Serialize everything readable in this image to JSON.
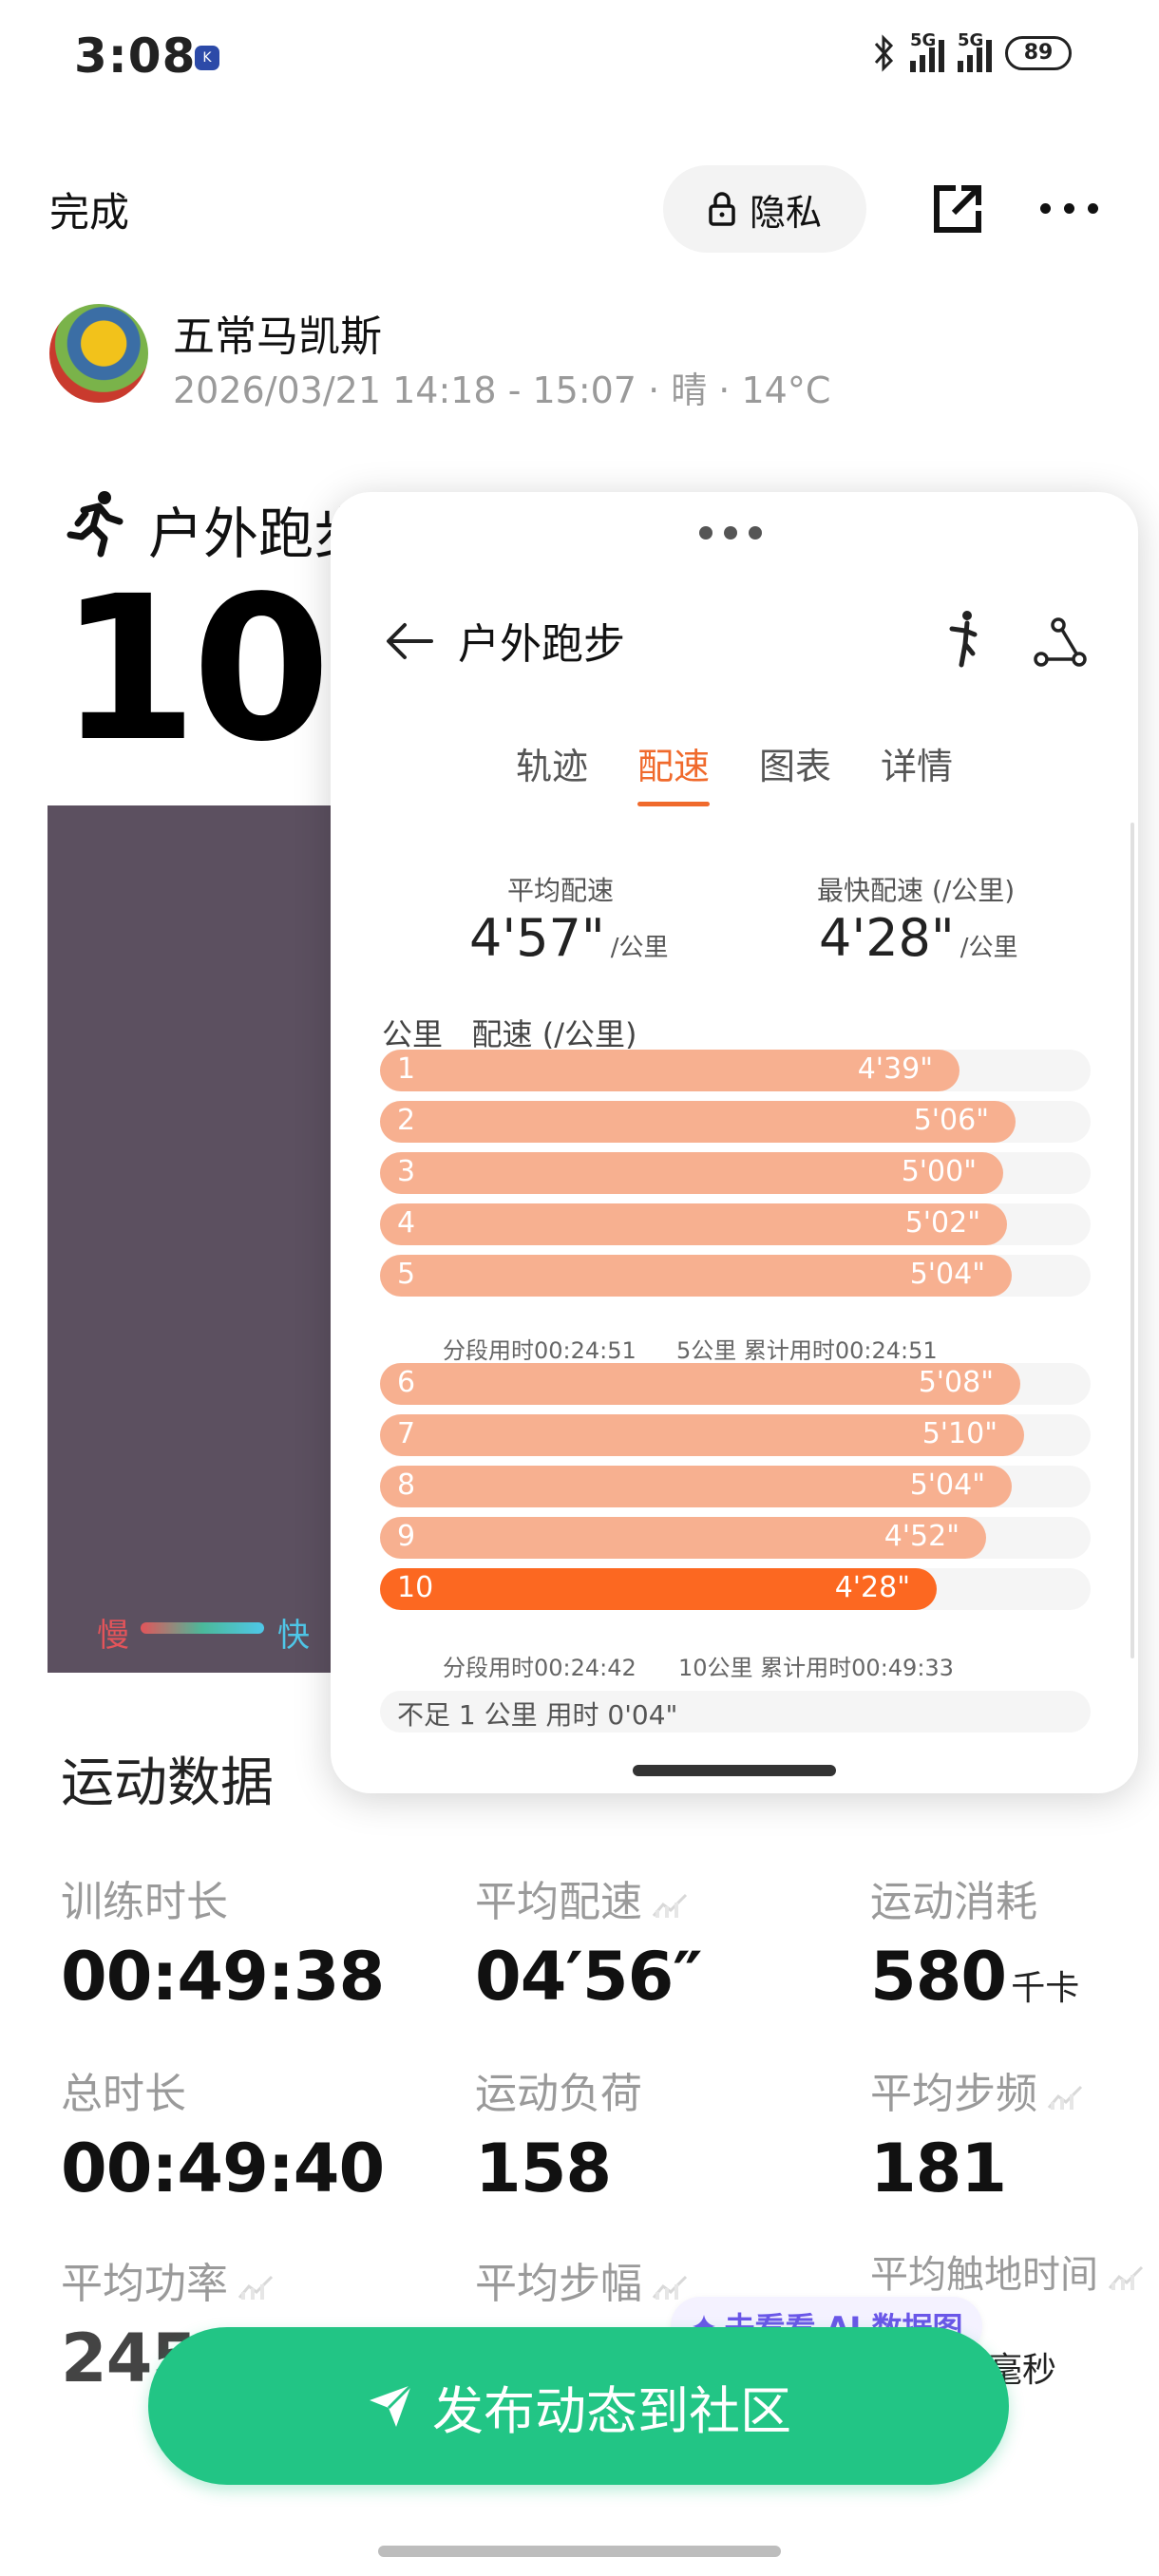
{
  "status": {
    "time": "3:08",
    "net1": "5G",
    "net2": "5G",
    "battery": "89"
  },
  "toolbar": {
    "done": "完成",
    "privacy": "隐私"
  },
  "user": {
    "name": "五常马凯斯",
    "meta": "2026/03/21 14:18 - 15:07 · 晴 · 14°C"
  },
  "run": {
    "title": "户外跑步",
    "distance_partial": "10.0"
  },
  "map_legend": {
    "slow": "慢",
    "fast": "快"
  },
  "card": {
    "title": "户外跑步",
    "tabs": [
      "轨迹",
      "配速",
      "图表",
      "详情"
    ],
    "active_tab": "配速",
    "avg_pace_label": "平均配速",
    "avg_pace": "4'57\"",
    "fast_pace_label": "最快配速 (/公里)",
    "fast_pace": "4'28\"",
    "pace_unit": "/公里",
    "col_km": "公里",
    "col_pace": "配速 (/公里)",
    "splits": [
      {
        "km": "1",
        "pace": "4'39\"",
        "fill": 0.815
      },
      {
        "km": "2",
        "pace": "5'06\"",
        "fill": 0.895
      },
      {
        "km": "3",
        "pace": "5'00\"",
        "fill": 0.877
      },
      {
        "km": "4",
        "pace": "5'02\"",
        "fill": 0.883
      },
      {
        "km": "5",
        "pace": "5'04\"",
        "fill": 0.889
      },
      {
        "km": "6",
        "pace": "5'08\"",
        "fill": 0.901
      },
      {
        "km": "7",
        "pace": "5'10\"",
        "fill": 0.907
      },
      {
        "km": "8",
        "pace": "5'04\"",
        "fill": 0.889
      },
      {
        "km": "9",
        "pace": "4'52\"",
        "fill": 0.853
      },
      {
        "km": "10",
        "pace": "4'28\"",
        "fill": 0.784,
        "fastest": true
      }
    ],
    "summary1": {
      "seg": "分段用时00:24:51",
      "cum": "5公里 累计用时00:24:51"
    },
    "summary2": {
      "seg": "分段用时00:24:42",
      "cum": "10公里 累计用时00:49:33"
    },
    "under_km": "不足 1 公里 用时 0'04\""
  },
  "sport": {
    "title": "运动数据",
    "stats": [
      {
        "label": "训练时长",
        "value": "00:49:38",
        "unit": ""
      },
      {
        "label": "平均配速",
        "value": "04′56″",
        "unit": "",
        "chart": true
      },
      {
        "label": "运动消耗",
        "value": "580",
        "unit": "千卡"
      },
      {
        "label": "总时长",
        "value": "00:49:40",
        "unit": ""
      },
      {
        "label": "运动负荷",
        "value": "158",
        "unit": ""
      },
      {
        "label": "平均步频",
        "value": "181",
        "unit": "",
        "chart": true
      },
      {
        "label": "平均功率",
        "value": "245",
        "unit": "",
        "chart": true
      },
      {
        "label": "平均步幅",
        "value": "",
        "unit": "",
        "chart": true
      },
      {
        "label": "平均触地时间",
        "value": "",
        "unit": "毫秒",
        "chart": true
      }
    ]
  },
  "ai_pill": "去看看 AI 数据图",
  "publish": "发布动态到社区"
}
